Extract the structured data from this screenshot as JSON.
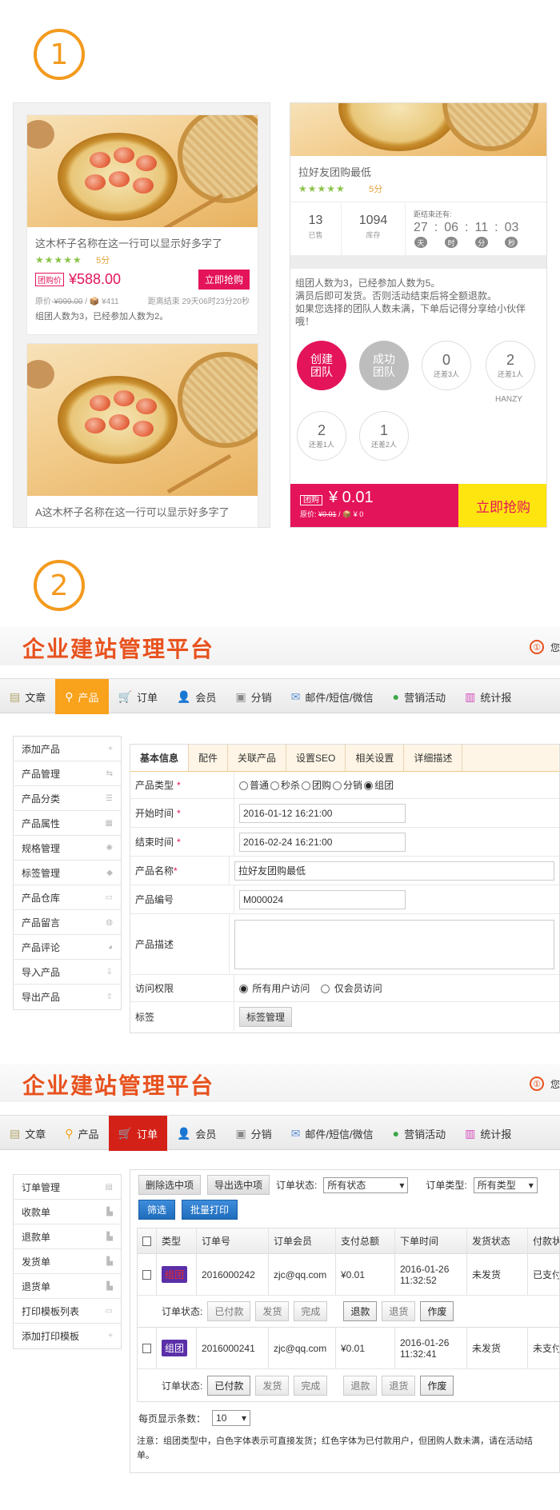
{
  "section1": {
    "number": "1",
    "left_phone": {
      "cards": [
        {
          "title": "这木杯子名称在这一行可以显示好多字了",
          "stars": "★★★★★",
          "score": "5分",
          "price_tag": "团购价",
          "price": "¥588.00",
          "buy_label": "立即抢购",
          "original_price": "原价-",
          "original_value": "¥999.00",
          "stock": "/ 📦 ¥411",
          "countdown": "距离结束 29天06时23分20秒",
          "people": "组团人数为3，已经参加人数为2。"
        },
        {
          "title": "A这木杯子名称在这一行可以显示好多字了"
        }
      ]
    },
    "right_phone": {
      "title": "拉好友团购最低",
      "stars": "★★★★★",
      "score": "5分",
      "stats": [
        {
          "number": "13",
          "label": "已售"
        },
        {
          "number": "1094",
          "label": "库存"
        }
      ],
      "countdown_label": "距结束还有:",
      "countdown": [
        {
          "value": "27",
          "unit": "天"
        },
        {
          "value": "06",
          "unit": "时"
        },
        {
          "value": "11",
          "unit": "分"
        },
        {
          "value": "03",
          "unit": "秒"
        }
      ],
      "desc_lines": [
        "组团人数为3，已经参加人数为5。",
        "满员后即可发货。否则活动结束后将全额退款。",
        "如果您选择的团队人数未满，下单后记得分享给小伙伴哦！"
      ],
      "teams": [
        {
          "top": "创建",
          "bottom": "团队",
          "style": "red"
        },
        {
          "top": "成功",
          "bottom": "团队",
          "style": "grey"
        },
        {
          "number": "0",
          "label": "还差3人"
        },
        {
          "number": "2",
          "label": "还差1人"
        },
        {
          "number": "2",
          "label": "还差1人"
        },
        {
          "number": "1",
          "label": "还差2人"
        }
      ],
      "team_member_name": "HANZY",
      "bottom": {
        "tag": "团购",
        "price": "¥ 0.01",
        "original_label": "原价:",
        "original_value": "¥0.01",
        "stock": "/ 📦 ¥ 0",
        "buy_label": "立即抢购"
      }
    }
  },
  "section2": {
    "number": "2"
  },
  "admin": {
    "title": "企业建站管理平台",
    "user_icon": "user-circle-icon",
    "user_text": "您",
    "nav": [
      {
        "label": "文章",
        "icon": "document-icon",
        "glyph": "▤"
      },
      {
        "label": "产品",
        "icon": "location-pin-icon",
        "glyph": "⚲"
      },
      {
        "label": "订单",
        "icon": "cart-icon",
        "glyph": "🛒"
      },
      {
        "label": "会员",
        "icon": "person-icon",
        "glyph": "👤"
      },
      {
        "label": "分销",
        "icon": "share-icon",
        "glyph": "▣"
      },
      {
        "label": "邮件/短信/微信",
        "icon": "mail-icon",
        "glyph": "✉"
      },
      {
        "label": "营销活动",
        "icon": "globe-icon",
        "glyph": "●"
      },
      {
        "label": "统计报",
        "icon": "bar-chart-icon",
        "glyph": "▥"
      }
    ],
    "accent_orange": "#f9a21c",
    "accent_red": "#d42117"
  },
  "product_panel": {
    "sidebar": [
      {
        "label": "添加产品",
        "icon": "+"
      },
      {
        "label": "产品管理",
        "icon": "⇆"
      },
      {
        "label": "产品分类",
        "icon": "☰"
      },
      {
        "label": "产品属性",
        "icon": "▦"
      },
      {
        "label": "规格管理",
        "icon": "✺"
      },
      {
        "label": "标签管理",
        "icon": "◆"
      },
      {
        "label": "产品仓库",
        "icon": "▭"
      },
      {
        "label": "产品留言",
        "icon": "◍"
      },
      {
        "label": "产品评论",
        "icon": "◕"
      },
      {
        "label": "导入产品",
        "icon": "⇩"
      },
      {
        "label": "导出产品",
        "icon": "⇧"
      }
    ],
    "tabs": [
      "基本信息",
      "配件",
      "关联产品",
      "设置SEO",
      "相关设置",
      "详细描述"
    ],
    "fields": {
      "type_label": "产品类型",
      "type_options": [
        "普通",
        "秒杀",
        "团购",
        "分销",
        "组团"
      ],
      "start_label": "开始时间",
      "start_value": "2016-01-12 16:21:00",
      "end_label": "结束时间",
      "end_value": "2016-02-24 16:21:00",
      "name_label": "产品名称",
      "name_value": "拉好友团购最低",
      "code_label": "产品编号",
      "code_value": "M000024",
      "desc_label": "产品描述",
      "access_label": "访问权限",
      "access_all": "所有用户访问",
      "access_member": "仅会员访问",
      "tag_label": "标签",
      "tag_button": "标签管理"
    }
  },
  "order_panel": {
    "sidebar": [
      {
        "label": "订单管理",
        "icon": "▤"
      },
      {
        "label": "收款单",
        "icon": "▙"
      },
      {
        "label": "退款单",
        "icon": "▙"
      },
      {
        "label": "发货单",
        "icon": "▙"
      },
      {
        "label": "退货单",
        "icon": "▙"
      },
      {
        "label": "打印模板列表",
        "icon": "▭"
      },
      {
        "label": "添加打印模板",
        "icon": "+"
      }
    ],
    "toolbar": {
      "delete_selected": "删除选中项",
      "export_selected": "导出选中项",
      "status_label": "订单状态:",
      "status_value": "所有状态",
      "type_label": "订单类型:",
      "type_value": "所有类型",
      "filter": "筛选",
      "batch_print": "批量打印"
    },
    "headers": [
      "类型",
      "订单号",
      "订单会员",
      "支付总额",
      "下单时间",
      "发货状态",
      "付款状"
    ],
    "rows": [
      {
        "type": "组团",
        "type_bg": "#5b2fa8",
        "type_color": "#e52b2b",
        "order_no": "2016000242",
        "member": "zjc@qq.com",
        "total": "¥0.01",
        "date": "2016-01-26",
        "time": "11:32:52",
        "ship": "未发货",
        "pay": "已支付",
        "status_label": "订单状态:",
        "actions": [
          "已付款",
          "发货",
          "完成",
          "退款",
          "退货",
          "作废"
        ]
      },
      {
        "type": "组团",
        "type_bg": "#5b2fa8",
        "type_color": "#ffffff",
        "order_no": "2016000241",
        "member": "zjc@qq.com",
        "total": "¥0.01",
        "date": "2016-01-26",
        "time": "11:32:41",
        "ship": "未发货",
        "pay": "未支付",
        "status_label": "订单状态:",
        "actions": [
          "已付款",
          "发货",
          "完成",
          "退款",
          "退货",
          "作废"
        ]
      }
    ],
    "per_page_label": "每页显示条数：",
    "per_page_value": "10",
    "note": "注意：组团类型中，白色字体表示可直接发货；红色字体为已付款用户，但团购人数未满，请在活动结",
    "note2": "单。"
  }
}
